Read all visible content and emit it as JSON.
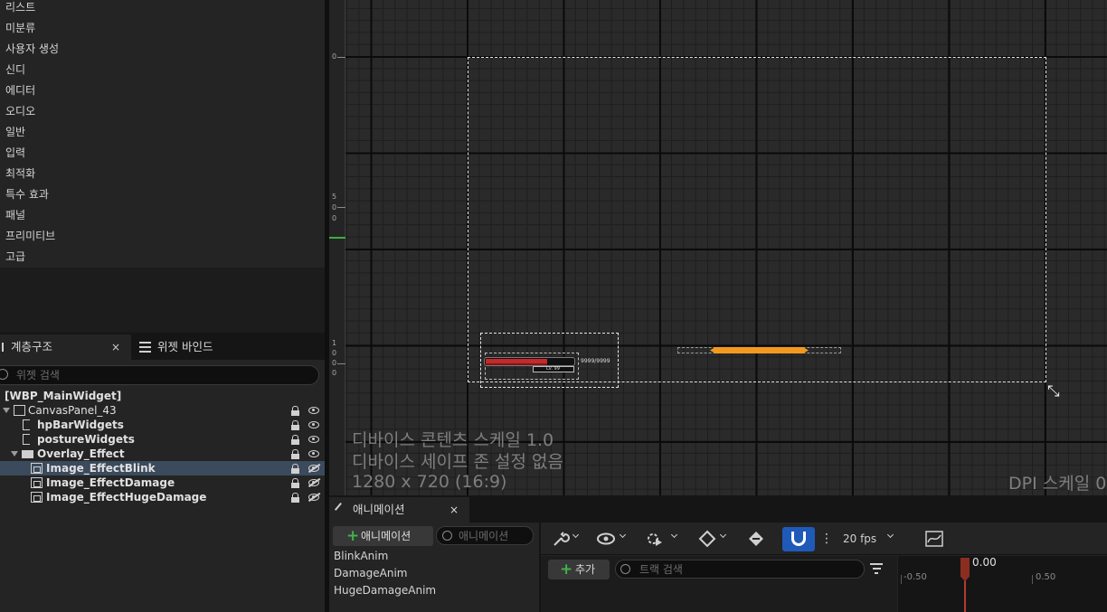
{
  "palette": {
    "categories": [
      "리스트",
      "미분류",
      "사용자 생성",
      "신디",
      "에디터",
      "오디오",
      "일반",
      "입력",
      "최적화",
      "특수 효과",
      "패널",
      "프리미티브",
      "고급"
    ]
  },
  "hierarchy": {
    "tab_label": "계층구조",
    "bindings_tab_label": "위젯 바인드",
    "close_glyph": "×",
    "search_placeholder": "위젯 검색",
    "items": [
      {
        "label": "[WBP_MainWidget]"
      },
      {
        "label": "CanvasPanel_43"
      },
      {
        "label": "hpBarWidgets"
      },
      {
        "label": "postureWidgets"
      },
      {
        "label": "Overlay_Effect"
      },
      {
        "label": "Image_EffectBlink"
      },
      {
        "label": "Image_EffectDamage"
      },
      {
        "label": "Image_EffectHugeDamage"
      }
    ]
  },
  "designer": {
    "ruler_labels": [
      "0",
      "5",
      "0",
      "0",
      "1",
      "0",
      "0",
      "0"
    ],
    "hp_text": "9999/9999",
    "level_text": "Lv. 99",
    "device_content_scale": "디바이스 콘텐츠 스케일 1.0",
    "device_safe_zone": "디바이스 세이프 존 설정 없음",
    "resolution": "1280 x 720 (16:9)",
    "dpi_scale": "DPI 스케일 0",
    "resize_glyph": "⤡"
  },
  "animations": {
    "tab_label": "애니메이션",
    "close_glyph": "×",
    "add_button_label": "애니메이션",
    "plus_glyph": "+",
    "search_placeholder": "애니메이션",
    "list": [
      "BlinkAnim",
      "DamageAnim",
      "HugeDamageAnim"
    ]
  },
  "sequencer": {
    "fps_label": "20 fps",
    "add_track_label": "추가",
    "track_search_placeholder": "트랙 검색",
    "playhead_time": "0.00",
    "time_labels": [
      "-0.50",
      "0.50"
    ]
  },
  "colors": {
    "accent_blue": "#1f5ab8",
    "hp_red": "#c4292b",
    "posture_orange": "#f39a1e",
    "selection": "#3b4a5c",
    "add_green": "#3fb24a"
  }
}
